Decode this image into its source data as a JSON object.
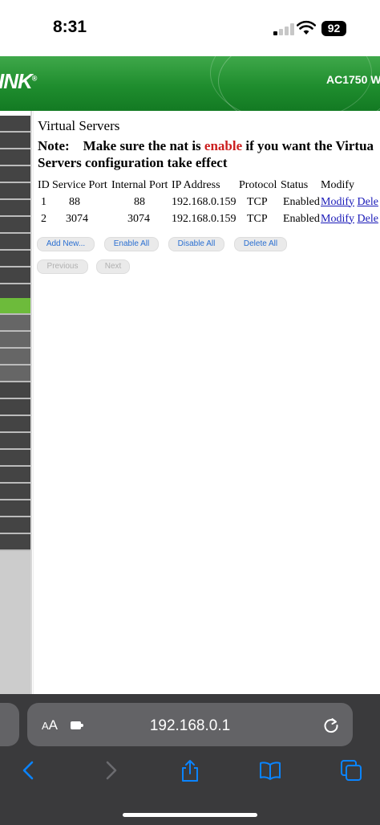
{
  "status_bar": {
    "time": "8:31",
    "battery": "92"
  },
  "router": {
    "logo": "INK",
    "logo_mark": "®",
    "model": "AC1750 W"
  },
  "page": {
    "title": "Virtual Servers",
    "note_label": "Note:",
    "note_text_1": "Make sure the nat is ",
    "note_highlight": "enable",
    "note_text_2": " if you want the Virtua",
    "note_line2": "Servers configuration take effect"
  },
  "table": {
    "headers": [
      "ID",
      "Service Port",
      "Internal Port",
      "IP Address",
      "Protocol",
      "Status",
      "Modify"
    ],
    "rows": [
      {
        "id": "1",
        "service_port": "88",
        "internal_port": "88",
        "ip": "192.168.0.159",
        "protocol": "TCP",
        "status": "Enabled",
        "modify": "Modify",
        "delete": "Dele"
      },
      {
        "id": "2",
        "service_port": "3074",
        "internal_port": "3074",
        "ip": "192.168.0.159",
        "protocol": "TCP",
        "status": "Enabled",
        "modify": "Modify",
        "delete": "Dele"
      }
    ]
  },
  "buttons": {
    "add_new": "Add New...",
    "enable_all": "Enable All",
    "disable_all": "Disable All",
    "delete_all": "Delete All",
    "previous": "Previous",
    "next": "Next"
  },
  "browser": {
    "aa_small": "A",
    "aa_large": "A",
    "url": "192.168.0.1"
  },
  "colors": {
    "header_green": "#1f8d2e",
    "active_menu": "#6dbb3b",
    "note_red": "#cc1f1f",
    "link_blue": "#1a1ab8",
    "button_text": "#2a6fd1",
    "browser_bar": "#3a3a3c"
  },
  "icons": [
    "signal-icon",
    "wifi-icon",
    "battery-icon",
    "extension-icon",
    "reload-icon",
    "back-icon",
    "forward-icon",
    "share-icon",
    "bookmarks-icon",
    "tabs-icon"
  ]
}
